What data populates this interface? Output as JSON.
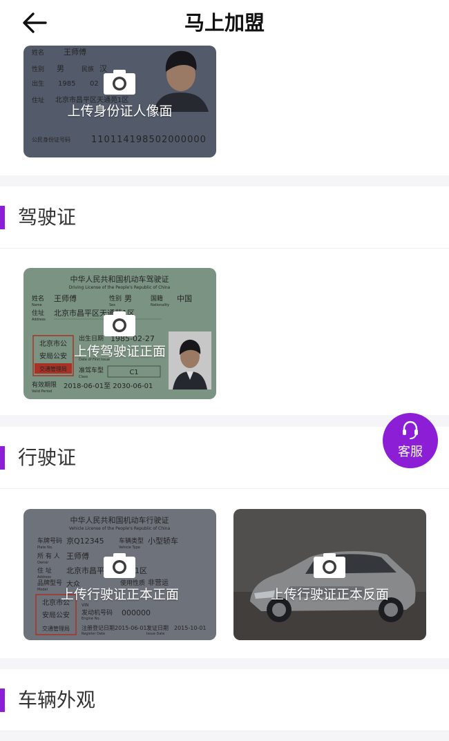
{
  "header": {
    "title": "马上加盟",
    "back_icon": "arrow-left-icon"
  },
  "id_card": {
    "upload_label": "上传身份证人像面",
    "name_label": "姓名",
    "name": "王师傅",
    "gender_label": "性别",
    "gender": "男",
    "ethnicity_label": "民族",
    "ethnicity": "汉",
    "birth_label": "出生",
    "birth_year": "1985",
    "birth_month": "02",
    "address_label": "住址",
    "address": "北京市昌平区天通苑1区",
    "number_label": "公民身份证号码",
    "number": "110114198502000000"
  },
  "driving_license": {
    "section_title": "驾驶证",
    "upload_label": "上传驾驶证正面",
    "card_title": "中华人民共和国机动车驾驶证",
    "card_subtitle": "Driving License of the People's Republic of China",
    "name_label": "姓名",
    "name_en": "Name",
    "name": "王师傅",
    "sex_label": "性别",
    "sex_en": "Sex",
    "sex": "男",
    "nationality_label": "国籍",
    "nationality_en": "Nationality",
    "nationality": "中国",
    "address_label": "住址",
    "address_en": "Address",
    "address": "北京市昌平区天通苑1区",
    "birth_label": "出生日期",
    "birth": "1985-02-27",
    "first_issue_label": "Date of First Issue",
    "class_label": "准驾车型",
    "class_en": "Class",
    "class": "C1",
    "valid_label": "有效期限",
    "valid_en": "Valid Period",
    "valid": "2018-06-01至 2030-06-01",
    "seal_lines": [
      "北京市公",
      "安局公安",
      "交通管理局"
    ]
  },
  "vehicle_license": {
    "section_title": "行驶证",
    "front_label": "上传行驶证正本正面",
    "back_label": "上传行驶证正本反面",
    "card_title": "中华人民共和国机动车行驶证",
    "card_subtitle": "Vehicle License of the People's Republic of China",
    "plate_label": "车牌号码",
    "plate_en": "Plate No.",
    "plate": "京Q12345",
    "type_label": "车辆类型",
    "type_en": "Vehicle Type",
    "type": "小型轿车",
    "owner_label": "所 有 人",
    "owner_en": "Owner",
    "owner": "王师傅",
    "address_label": "住    址",
    "address_en": "Address",
    "address": "北京市昌平区天通苑1区",
    "use_label": "使用性质",
    "use": "非营运",
    "model_label": "品牌型号",
    "model_en": "Model",
    "model": "大众",
    "vin_label": "VIN",
    "engine_label": "发动机号码",
    "engine_en": "Engine No.",
    "engine": "000000",
    "reg_label": "注册登记日期",
    "reg_en": "Register Date",
    "reg": "2015-06-01",
    "issue_label": "发证日期",
    "issue_en": "Issue Date",
    "issue": "2015-10-01",
    "seal_lines": [
      "北京市公",
      "安局公安",
      "交通管理局"
    ]
  },
  "vehicle_exterior": {
    "section_title": "车辆外观"
  },
  "service": {
    "label": "客服",
    "icon": "headset-icon"
  },
  "colors": {
    "accent": "#8c1fd6",
    "background": "#f5f5f7"
  }
}
